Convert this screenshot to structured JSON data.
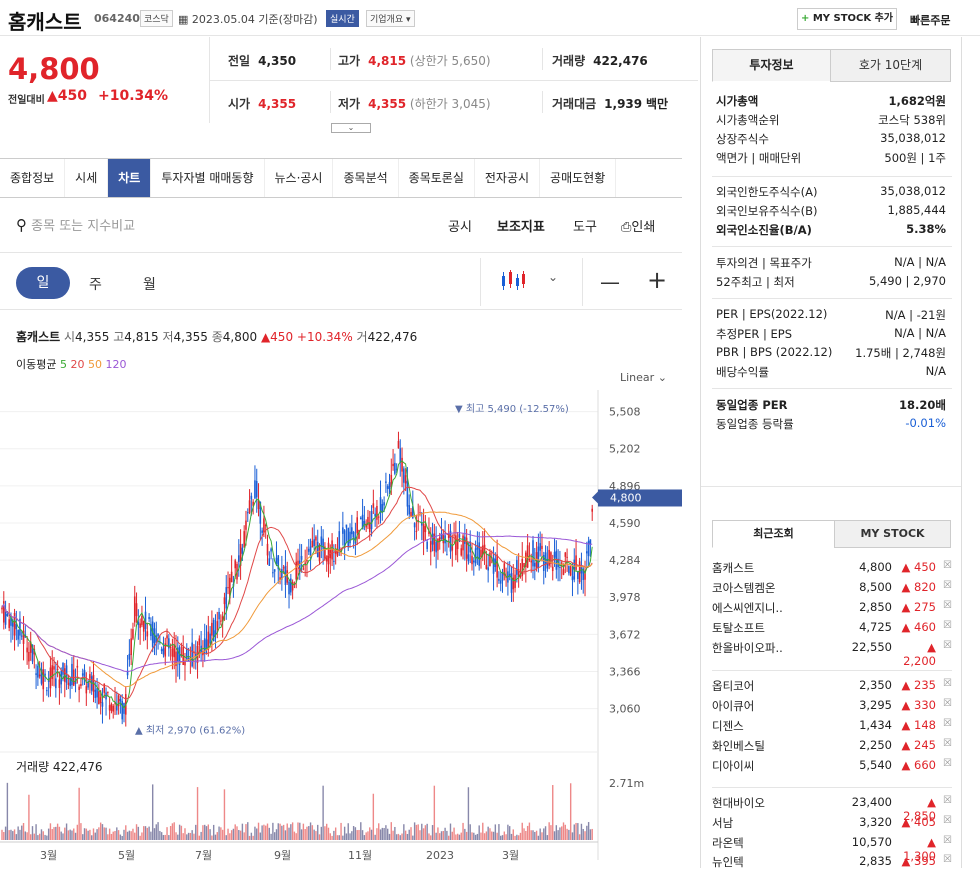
{
  "header": {
    "name": "홈캐스트",
    "code": "064240",
    "market": "코스닥",
    "date": "2023.05.04 기준(장마감)",
    "realtime": "실시간",
    "company_info": "기업개요",
    "mystock_btn": "MY STOCK 추가",
    "quick_order": "빠른주문"
  },
  "price": {
    "current": "4,800",
    "change_label": "전일대비",
    "change": "450",
    "change_pct": "+10.34%"
  },
  "summary": {
    "prev_label": "전일",
    "prev": "4,350",
    "open_label": "시가",
    "open": "4,355",
    "high_label": "고가",
    "high": "4,815",
    "upper_limit": "(상한가 5,650)",
    "low_label": "저가",
    "low": "4,355",
    "lower_limit": "(하한가 3,045)",
    "vol_label": "거래량",
    "vol": "422,476",
    "amount_label": "거래대금",
    "amount": "1,939",
    "amount_unit": "백만"
  },
  "tabs": [
    "종합정보",
    "시세",
    "차트",
    "투자자별 매매동향",
    "뉴스·공시",
    "종목분석",
    "종목토론실",
    "전자공시",
    "공매도현황"
  ],
  "chart_toolbar": {
    "search_placeholder": "종목 또는 지수비교",
    "disclosure": "공시",
    "indicator": "보조지표",
    "tools": "도구",
    "print": "인쇄"
  },
  "periods": {
    "day": "일",
    "week": "주",
    "month": "월"
  },
  "chart_info": {
    "name": "홈캐스트",
    "open_l": "시",
    "open": "4,355",
    "high_l": "고",
    "high": "4,815",
    "low_l": "저",
    "low": "4,355",
    "close_l": "종",
    "close": "4,800",
    "chg": "450",
    "chg_pct": "+10.34%",
    "vol_l": "거",
    "vol": "422,476"
  },
  "ma": {
    "label": "이동평균",
    "p5": "5",
    "p20": "20",
    "p50": "50",
    "p120": "120"
  },
  "scale": "Linear",
  "chart_data": {
    "type": "line",
    "y_ticks": [
      "5,508",
      "5,202",
      "4,896",
      "4,590",
      "4,284",
      "3,978",
      "3,672",
      "3,366",
      "3,060"
    ],
    "x_ticks": [
      "3월",
      "5월",
      "7월",
      "9월",
      "11월",
      "2023",
      "3월"
    ],
    "current_price": "4,800",
    "max_label": "최고 5,490 (-12.57%)",
    "min_label": "최저 2,970 (61.62%)",
    "volume_label": "거래량",
    "volume": "422,476",
    "volume_tick": "2.71m",
    "colors": {
      "up": "#e0242a",
      "down": "#1a5fd6",
      "ma5": "#3aaa35",
      "ma20": "#e04848",
      "ma50": "#f09a3a",
      "ma120": "#9a57d6"
    }
  },
  "right_tabs": {
    "invest": "투자정보",
    "hoga": "호가 10단계"
  },
  "invest": [
    {
      "k": "시가총액",
      "v": "1,682억원",
      "bold": true
    },
    {
      "k": "시가총액순위",
      "v": "코스닥 538위"
    },
    {
      "k": "상장주식수",
      "v": "35,038,012"
    },
    {
      "k": "액면가 | 매매단위",
      "v": "500원 | 1주"
    },
    {
      "k": "외국인한도주식수(A)",
      "v": "35,038,012"
    },
    {
      "k": "외국인보유주식수(B)",
      "v": "1,885,444"
    },
    {
      "k": "외국인소진율(B/A)",
      "v": "5.38%",
      "bold": true
    },
    {
      "k": "투자의견 | 목표주가",
      "v": "N/A | N/A"
    },
    {
      "k": "52주최고 | 최저",
      "v": "5,490 | 2,970"
    },
    {
      "k": "PER | EPS(2022.12)",
      "v": "N/A | -21원"
    },
    {
      "k": "추정PER | EPS",
      "v": "N/A | N/A"
    },
    {
      "k": "PBR | BPS (2022.12)",
      "v": "1.75배 | 2,748원"
    },
    {
      "k": "배당수익률",
      "v": "N/A"
    },
    {
      "k": "동일업종 PER",
      "v": "18.20배",
      "bold": true
    },
    {
      "k": "동일업종 등락률",
      "v": "-0.01%",
      "blue": true
    }
  ],
  "recent_tabs": {
    "recent": "최근조회",
    "mystock": "MY STOCK"
  },
  "recent": [
    {
      "n": "홈캐스트",
      "p": "4,800",
      "c": "450"
    },
    {
      "n": "코아스템켐온",
      "p": "8,500",
      "c": "820"
    },
    {
      "n": "에스씨엔지니..",
      "p": "2,850",
      "c": "275"
    },
    {
      "n": "토탈소프트",
      "p": "4,725",
      "c": "460"
    },
    {
      "n": "한올바이오파..",
      "p": "22,550",
      "c": "2,200"
    },
    {
      "n": "옵티코어",
      "p": "2,350",
      "c": "235"
    },
    {
      "n": "아이큐어",
      "p": "3,295",
      "c": "330"
    },
    {
      "n": "디젠스",
      "p": "1,434",
      "c": "148"
    },
    {
      "n": "화인베스틸",
      "p": "2,250",
      "c": "245"
    },
    {
      "n": "디아이씨",
      "p": "5,540",
      "c": "660"
    },
    {
      "n": "현대바이오",
      "p": "23,400",
      "c": "2,850"
    },
    {
      "n": "서남",
      "p": "3,320",
      "c": "405"
    },
    {
      "n": "라온텍",
      "p": "10,570",
      "c": "1,300"
    },
    {
      "n": "뉴인텍",
      "p": "2,835",
      "c": "395"
    }
  ]
}
